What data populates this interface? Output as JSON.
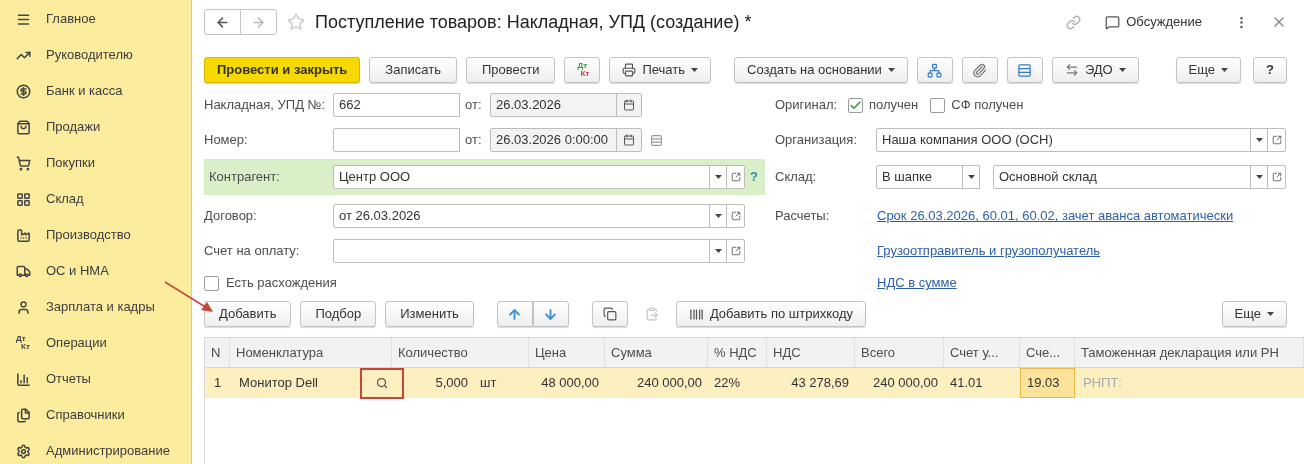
{
  "sidebar": {
    "items": [
      {
        "label": "Главное",
        "selected": false
      },
      {
        "label": "Руководителю",
        "selected": false
      },
      {
        "label": "Банк и касса",
        "selected": false
      },
      {
        "label": "Продажи",
        "selected": false
      },
      {
        "label": "Покупки",
        "selected": false
      },
      {
        "label": "Склад",
        "selected": false
      },
      {
        "label": "Производство",
        "selected": false
      },
      {
        "label": "ОС и НМА",
        "selected": false
      },
      {
        "label": "Зарплата и кадры",
        "selected": false
      },
      {
        "label": "Операции",
        "selected": false,
        "glyph_top": "Дт",
        "glyph_bottom": "Кт"
      },
      {
        "label": "Отчеты",
        "selected": false
      },
      {
        "label": "Справочники",
        "selected": false
      },
      {
        "label": "Администрирование",
        "selected": false
      }
    ]
  },
  "window": {
    "title": "Поступление товаров: Накладная, УПД (создание) *",
    "discussion": "Обсуждение"
  },
  "toolbar": {
    "items": [
      {
        "kind": "primary",
        "label": "Провести и закрыть"
      },
      {
        "kind": "button",
        "label": "Записать"
      },
      {
        "kind": "button",
        "label": "Провести"
      },
      {
        "kind": "postings",
        "glyph_top": "Дт",
        "glyph_bottom": "Кт"
      },
      {
        "kind": "print",
        "label": "Печать"
      },
      {
        "kind": "menu",
        "label": "Создать на основании"
      },
      {
        "kind": "structure"
      },
      {
        "kind": "attach"
      },
      {
        "kind": "list"
      },
      {
        "kind": "edo",
        "label": "ЭДО"
      }
    ],
    "more": "Еще",
    "help": "?"
  },
  "form": {
    "invoice": {
      "label": "Накладная, УПД №:",
      "value": "662",
      "date_label": "от:",
      "date": "26.03.2026"
    },
    "number": {
      "label": "Номер:",
      "date_label": "от:",
      "date": "26.03.2026  0:00:00"
    },
    "counterparty": {
      "label": "Контрагент:",
      "value": "Центр ООО",
      "highlighted": true,
      "help": "?"
    },
    "contract": {
      "label": "Договор:",
      "value": "от 26.03.2026"
    },
    "payment_invoice": {
      "label": "Счет на оплату:"
    },
    "discrepancies": {
      "label": "Есть расхождения",
      "checked": false
    },
    "original": {
      "label": "Оригинал:",
      "checkboxes": [
        {
          "label": "получен",
          "checked": true
        },
        {
          "label": "СФ получен",
          "checked": false
        }
      ]
    },
    "organization": {
      "label": "Организация:",
      "value": "Наша компания ООО (ОСН)"
    },
    "warehouse": {
      "label": "Склад:",
      "mode": "В шапке",
      "value": "Основной склад"
    },
    "settlements": {
      "label": "Расчеты:",
      "link": "Срок 26.03.2026, 60.01, 60.02, зачет аванса автоматически"
    },
    "links": [
      "Грузоотправитель и грузополучатель",
      "НДС в сумме"
    ]
  },
  "table_toolbar": {
    "items": [
      {
        "kind": "button",
        "label": "Добавить",
        "disabled": false
      },
      {
        "kind": "button",
        "label": "Подбор",
        "disabled": false
      },
      {
        "kind": "button",
        "label": "Изменить",
        "disabled": false
      },
      {
        "kind": "up",
        "disabled": false
      },
      {
        "kind": "down",
        "disabled": false
      },
      {
        "kind": "copy",
        "disabled": false
      },
      {
        "kind": "paste",
        "disabled": true
      },
      {
        "kind": "barcode",
        "label": "Добавить по штрихкоду",
        "disabled": false
      }
    ],
    "more": "Еще"
  },
  "table": {
    "columns": [
      "N",
      "Номенклатура",
      "Количество",
      "Цена",
      "Сумма",
      "% НДС",
      "НДС",
      "Всего",
      "Счет у...",
      "Сче...",
      "Таможенная декларация или РН"
    ],
    "rows": [
      {
        "selected": true,
        "vat_account_current": true,
        "n": "1",
        "item": "Монитор Dell",
        "quantity": "5,000",
        "unit": "шт",
        "price": "48 000,00",
        "sum": "240 000,00",
        "vat_rate": "22%",
        "vat": "43 278,69",
        "total": "240 000,00",
        "account": "41.01",
        "vat_account": "19.03",
        "customs": "РНПТ:"
      }
    ]
  }
}
